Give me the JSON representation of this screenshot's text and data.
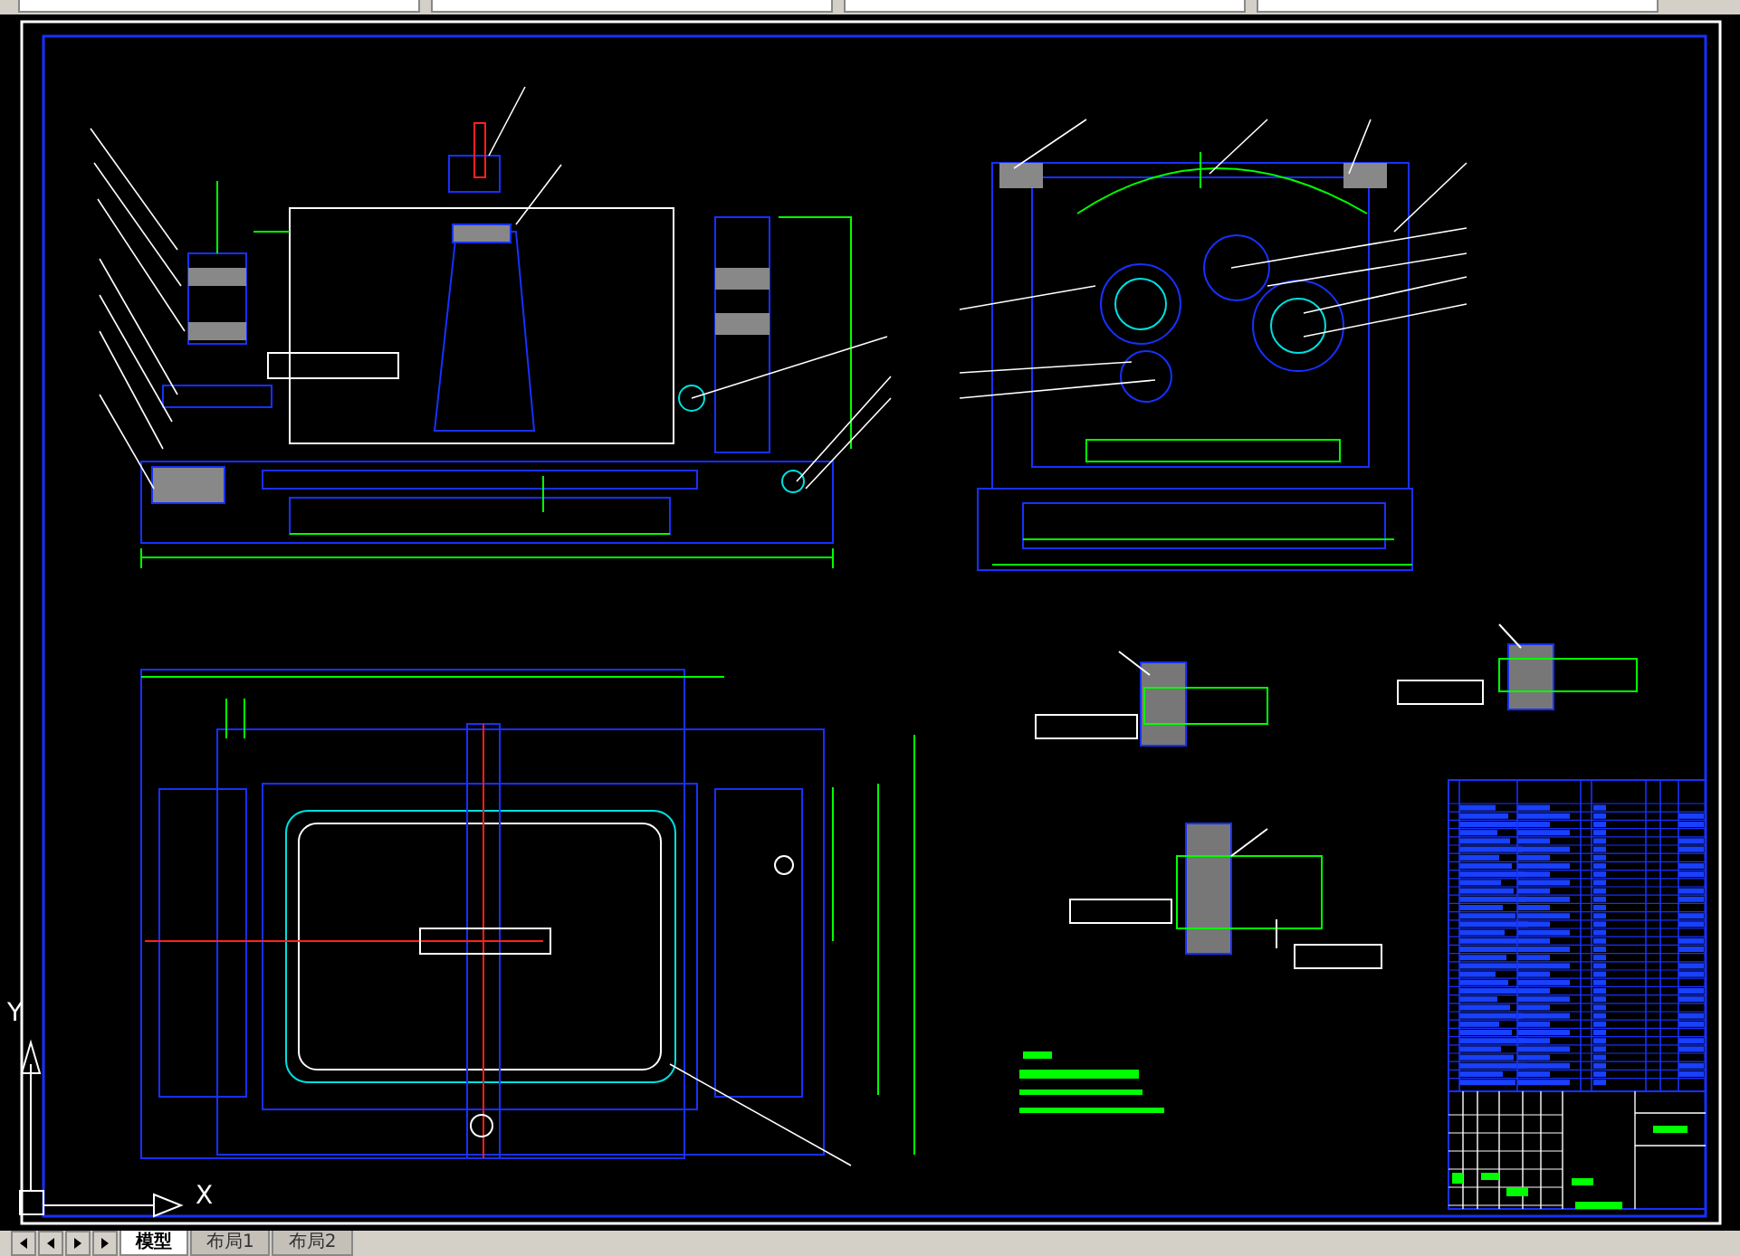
{
  "canvas": {
    "ucs_icon": {
      "x_label": "X",
      "y_label": "Y"
    }
  },
  "layout_tabs": [
    {
      "label": "模型",
      "selected": true
    },
    {
      "label": "布局1",
      "selected": false
    },
    {
      "label": "布局2",
      "selected": false
    }
  ]
}
